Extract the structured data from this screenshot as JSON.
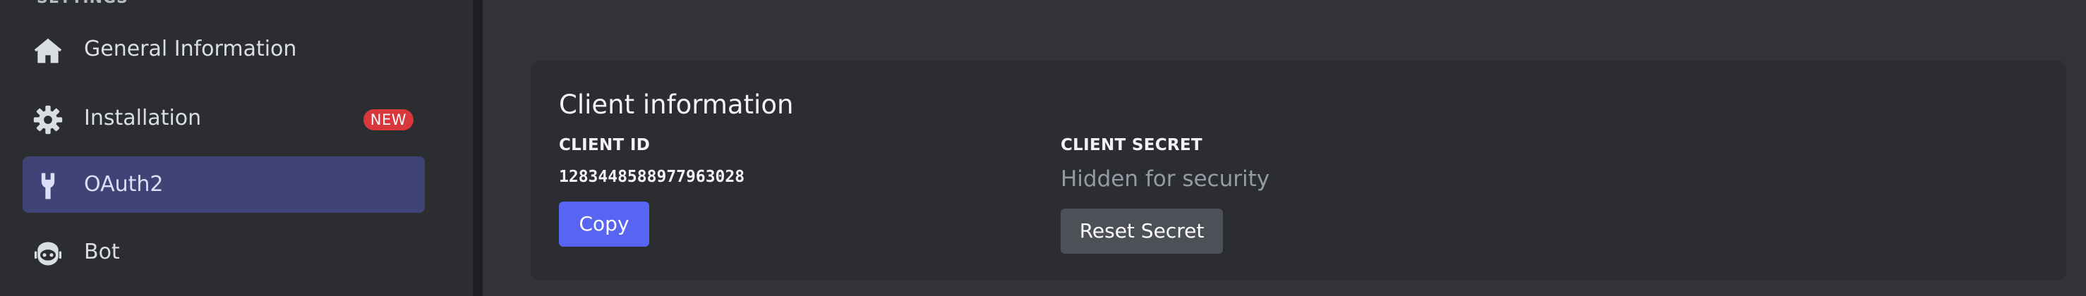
{
  "sidebar": {
    "section_label": "SETTINGS",
    "items": [
      {
        "label": "General Information",
        "icon": "home-icon"
      },
      {
        "label": "Installation",
        "icon": "gear-icon",
        "badge": "NEW"
      },
      {
        "label": "OAuth2",
        "icon": "wrench-icon",
        "active": true
      },
      {
        "label": "Bot",
        "icon": "bot-icon"
      }
    ]
  },
  "client_info": {
    "title": "Client information",
    "client_id_label": "CLIENT ID",
    "client_id_value": "1283448588977963028",
    "copy_label": "Copy",
    "client_secret_label": "CLIENT SECRET",
    "client_secret_value": "Hidden for security",
    "reset_label": "Reset Secret"
  },
  "colors": {
    "accent": "#5865f2",
    "active_nav": "#404375",
    "badge": "#da373c",
    "background": "#313338",
    "sidebar": "#2b2d31"
  }
}
